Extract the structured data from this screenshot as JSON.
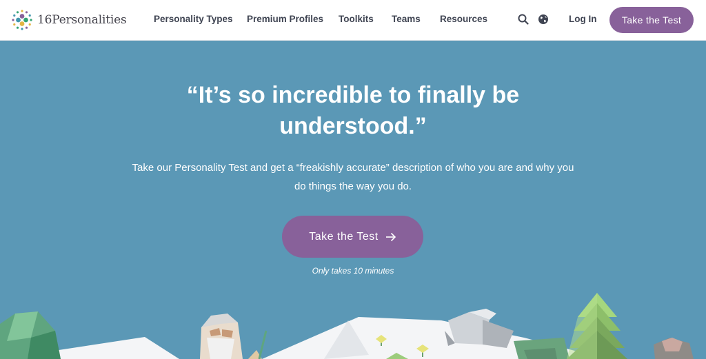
{
  "header": {
    "logo_text": "16Personalities",
    "nav": [
      "Personality Types",
      "Premium Profiles",
      "Toolkits",
      "Teams",
      "Resources"
    ],
    "login_label": "Log In",
    "cta_label": "Take the Test",
    "icons": [
      "search-icon",
      "globe-icon"
    ]
  },
  "hero": {
    "title": "“It’s so incredible to finally be understood.”",
    "subtitle": "Take our Personality Test and get a “freakishly accurate” description of who you are and why you do things the way you do.",
    "cta_label": "Take the Test",
    "note": "Only takes 10 minutes"
  },
  "colors": {
    "accent": "#88619a",
    "background": "#5b98b6",
    "header_bg": "#ffffff",
    "nav_text": "#3f4452"
  }
}
